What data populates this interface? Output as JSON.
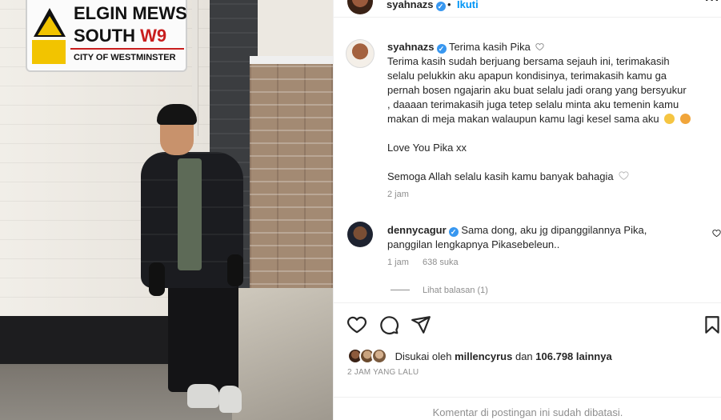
{
  "photo": {
    "sign": {
      "line1": "ELGIN MEWS",
      "line2_text": "SOUTH",
      "line2_code": "W9",
      "line3": "CITY OF WESTMINSTER"
    }
  },
  "header": {
    "username": "syahnazs",
    "separator": "•",
    "follow_label": "Ikuti",
    "more_label": "···"
  },
  "caption": {
    "username": "syahnazs",
    "lines": [
      "Terima kasih Pika",
      "Terima kasih sudah berjuang bersama sejauh ini, terimakasih",
      "selalu pelukkin aku apapun kondisinya, terimakasih kamu ga",
      "pernah bosen ngajarin aku buat selalu jadi orang yang bersyukur",
      ", daaaan terimakasih juga tetep selalu minta aku temenin kamu",
      "makan di meja makan walaupun kamu lagi kesel sama aku"
    ],
    "love_line": "Love You Pika xx",
    "prayer_line": "Semoga Allah selalu kasih kamu banyak bahagia",
    "time": "2 jam"
  },
  "comment": {
    "username": "dennycagur",
    "line1": "Sama dong, aku jg dipanggilannya Pika,",
    "line2": "panggilan lengkapnya Pikasebeleun..",
    "time": "1 jam",
    "likes": "638 suka",
    "replies_label": "Lihat balasan (1)"
  },
  "likes": {
    "prefix": "Disukai oleh",
    "user": "millencyrus",
    "joiner": "dan",
    "count": "106.798 lainnya"
  },
  "posted_ago": "2 JAM YANG LALU",
  "footer_text": "Komentar di postingan ini sudah dibatasi.",
  "icons": [
    "heart-icon",
    "comment-icon",
    "share-icon",
    "bookmark-icon",
    "verified-icon"
  ],
  "colors": {
    "accent": "#0095f6",
    "verified": "#3897f0",
    "muted": "#8e8e8e",
    "text": "#262626"
  }
}
